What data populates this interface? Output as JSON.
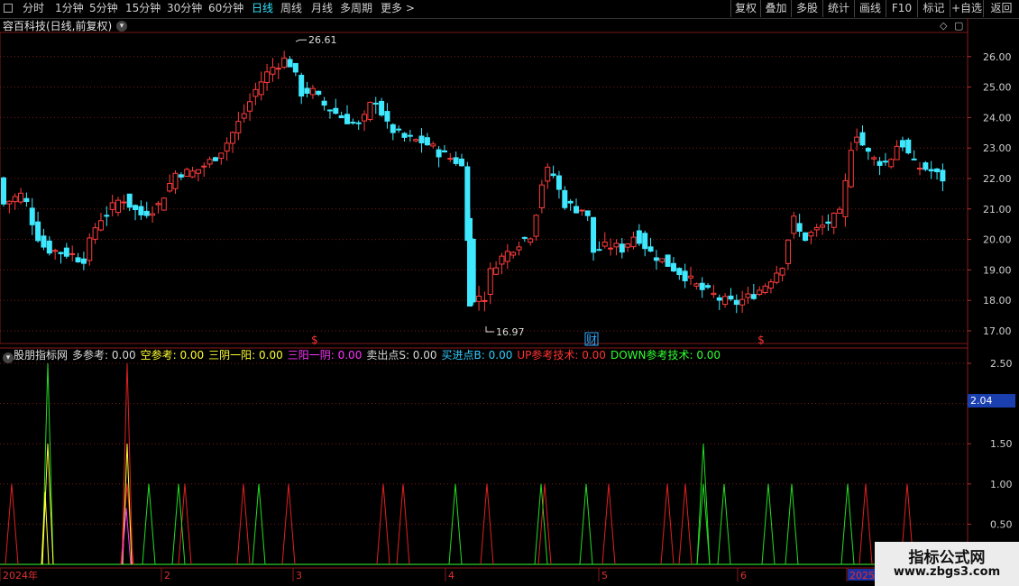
{
  "toolbar": {
    "periods": [
      {
        "label": "分时"
      },
      {
        "label": "1分钟"
      },
      {
        "label": "5分钟"
      },
      {
        "label": "15分钟"
      },
      {
        "label": "30分钟"
      },
      {
        "label": "60分钟"
      },
      {
        "label": "日线"
      },
      {
        "label": "周线"
      },
      {
        "label": "月线"
      },
      {
        "label": "多周期"
      },
      {
        "label": "更多 >"
      }
    ],
    "active_period": "日线",
    "actions": [
      {
        "label": "复权"
      },
      {
        "label": "叠加"
      },
      {
        "label": "多股"
      },
      {
        "label": "统计"
      },
      {
        "label": "画线"
      },
      {
        "label": "F10"
      },
      {
        "label": "标记"
      },
      {
        "label": "+自选"
      },
      {
        "label": "返回"
      }
    ]
  },
  "stock": {
    "title": "容百科技(日线,前复权)"
  },
  "price_chart": {
    "y_ticks": [
      "26.00",
      "25.00",
      "24.00",
      "23.00",
      "22.00",
      "21.00",
      "20.00",
      "19.00",
      "18.00",
      "17.00"
    ],
    "high_label": "26.61",
    "low_label": "16.97",
    "event_markers": [
      {
        "label": "$",
        "color": "#ff3333"
      },
      {
        "label": "财",
        "color": "#33aaff"
      },
      {
        "label": "$",
        "color": "#ff3333"
      }
    ],
    "colors": {
      "up": "#ff3c3c",
      "down": "#3ee8ff",
      "grid": "#7a1a1a"
    }
  },
  "indicator": {
    "name": "股朋指标网",
    "fields": [
      {
        "label": "多参考: 0.00",
        "color": "#d8d8d8"
      },
      {
        "label": "空参考: 0.00",
        "color": "#ffff33"
      },
      {
        "label": "三阴一阳: 0.00",
        "color": "#ffff33"
      },
      {
        "label": "三阳一阴: 0.00",
        "color": "#ff33ff"
      },
      {
        "label": "卖出点S: 0.00",
        "color": "#d8d8d8"
      },
      {
        "label": "买进点B: 0.00",
        "color": "#33ccff"
      },
      {
        "label": "UP参考技术: 0.00",
        "color": "#ff3333"
      },
      {
        "label": "DOWN参考技术: 0.00",
        "color": "#33ff33"
      }
    ],
    "y_ticks": [
      "2.50",
      "2.00",
      "1.50",
      "1.00",
      "0.50"
    ],
    "current_value": "2.04"
  },
  "time_axis": [
    "2024年",
    "2",
    "3",
    "4",
    "5",
    "6",
    "2025/"
  ],
  "watermark": {
    "title": "指标公式网",
    "url": "www.zbgs3.com"
  }
}
